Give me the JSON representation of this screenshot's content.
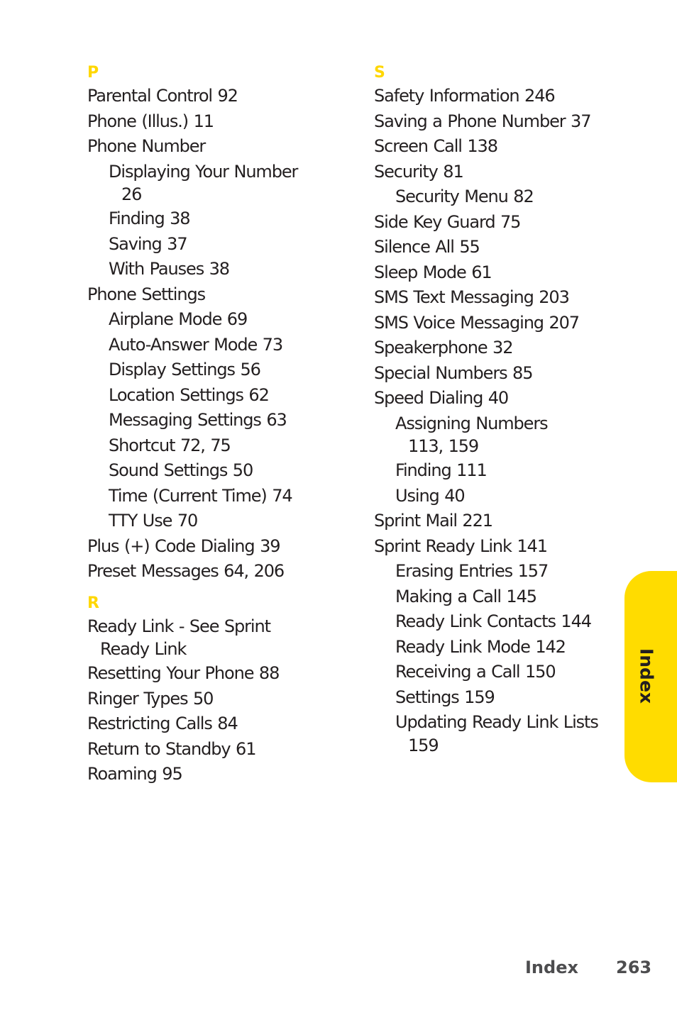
{
  "sections": [
    {
      "letter": "P",
      "entries": [
        {
          "text": "Parental Control 92",
          "level": 0
        },
        {
          "text": "Phone (Illus.) 11",
          "level": 0
        },
        {
          "text": "Phone Number",
          "level": 0
        },
        {
          "text": "Displaying Your Number",
          "cont": "26",
          "level": 1
        },
        {
          "text": "Finding 38",
          "level": 1
        },
        {
          "text": "Saving 37",
          "level": 1
        },
        {
          "text": "With Pauses 38",
          "level": 1
        },
        {
          "text": "Phone Settings",
          "level": 0
        },
        {
          "text": "Airplane Mode 69",
          "level": 1
        },
        {
          "text": "Auto-Answer Mode 73",
          "level": 1
        },
        {
          "text": "Display Settings 56",
          "level": 1
        },
        {
          "text": "Location Settings 62",
          "level": 1
        },
        {
          "text": "Messaging Settings 63",
          "level": 1
        },
        {
          "text": "Shortcut 72, 75",
          "level": 1
        },
        {
          "text": "Sound Settings 50",
          "level": 1
        },
        {
          "text": "Time (Current Time) 74",
          "level": 1
        },
        {
          "text": "TTY Use 70",
          "level": 1
        },
        {
          "text": "Plus (+) Code Dialing 39",
          "level": 0
        },
        {
          "text": "Preset Messages 64, 206",
          "level": 0
        }
      ]
    },
    {
      "letter": "R",
      "entries": [
        {
          "text": "Ready Link - See Sprint",
          "cont": "Ready Link",
          "level": 0
        },
        {
          "text": "Resetting Your Phone 88",
          "level": 0
        },
        {
          "text": "Ringer Types 50",
          "level": 0
        },
        {
          "text": "Restricting Calls 84",
          "level": 0
        },
        {
          "text": "Return to Standby 61",
          "level": 0
        },
        {
          "text": "Roaming 95",
          "level": 0
        }
      ]
    },
    {
      "letter": "S",
      "entries": [
        {
          "text": "Safety Information 246",
          "level": 0
        },
        {
          "text": "Saving a Phone Number 37",
          "level": 0
        },
        {
          "text": "Screen Call 138",
          "level": 0
        },
        {
          "text": "Security 81",
          "level": 0
        },
        {
          "text": "Security Menu 82",
          "level": 1
        },
        {
          "text": "Side Key Guard 75",
          "level": 0
        },
        {
          "text": "Silence All 55",
          "level": 0
        },
        {
          "text": "Sleep Mode 61",
          "level": 0
        },
        {
          "text": "SMS Text Messaging 203",
          "level": 0
        },
        {
          "text": "SMS Voice Messaging 207",
          "level": 0
        },
        {
          "text": "Speakerphone 32",
          "level": 0
        },
        {
          "text": "Special Numbers 85",
          "level": 0
        },
        {
          "text": "Speed Dialing 40",
          "level": 0
        },
        {
          "text": "Assigning Numbers",
          "cont": "113, 159",
          "level": 1
        },
        {
          "text": "Finding 111",
          "level": 1
        },
        {
          "text": "Using 40",
          "level": 1
        },
        {
          "text": "Sprint Mail 221",
          "level": 0
        },
        {
          "text": "Sprint Ready Link 141",
          "level": 0
        },
        {
          "text": "Erasing Entries 157",
          "level": 1
        },
        {
          "text": "Making a Call 145",
          "level": 1
        },
        {
          "text": "Ready Link Contacts 144",
          "level": 1
        },
        {
          "text": "Ready Link Mode 142",
          "level": 1
        },
        {
          "text": "Receiving a Call 150",
          "level": 1
        },
        {
          "text": "Settings 159",
          "level": 1
        },
        {
          "text": "Updating Ready Link Lists",
          "cont": "159",
          "level": 1
        }
      ]
    }
  ],
  "side_tab": {
    "label": "Index"
  },
  "footer": {
    "section": "Index",
    "page_number": "263"
  },
  "colors": {
    "accent_yellow": "#ffdc00",
    "text": "#231f20",
    "footer_text": "#4d4d4f"
  }
}
